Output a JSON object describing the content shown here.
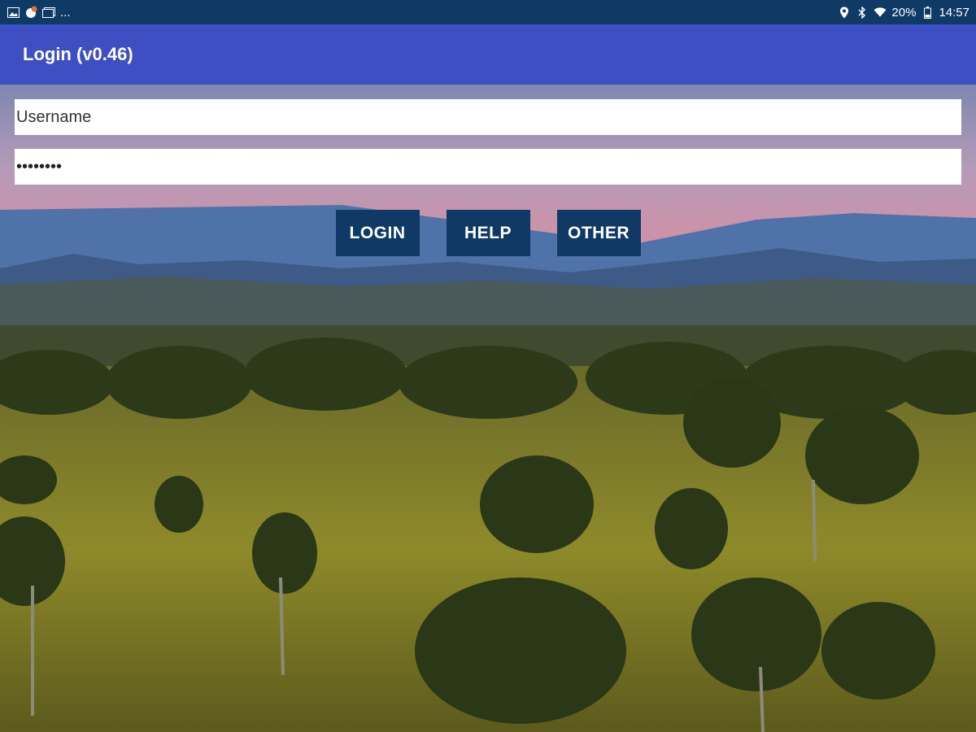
{
  "status_bar": {
    "left_overflow": "...",
    "battery_percent": "20%",
    "time": "14:57",
    "icons_left": [
      "image-icon",
      "app-notification-icon",
      "gallery-icon"
    ],
    "icons_right": [
      "location-icon",
      "bluetooth-icon",
      "wifi-icon",
      "battery-icon"
    ]
  },
  "app_bar": {
    "title": "Login (v0.46)"
  },
  "form": {
    "username": {
      "value": "",
      "placeholder": "Username"
    },
    "password": {
      "value": "********",
      "placeholder": ""
    }
  },
  "buttons": {
    "login": "LOGIN",
    "help": "HELP",
    "other": "OTHER"
  },
  "colors": {
    "status_bar": "#0f3a66",
    "app_bar": "#3d4fc2",
    "button": "#0f3a66",
    "field": "#ffffff"
  }
}
